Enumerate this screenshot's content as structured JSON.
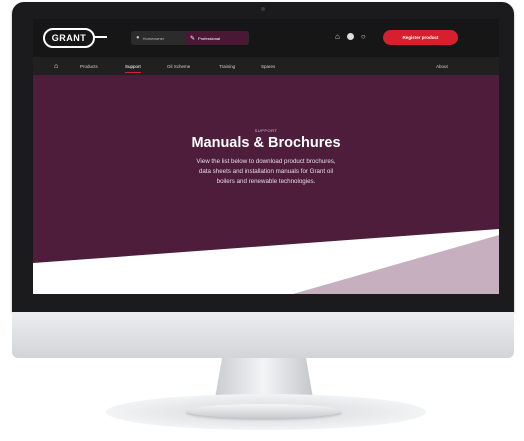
{
  "header": {
    "logo_text": "GRANT",
    "toggle": {
      "homeowner_label": "Homeowner",
      "professional_label": "Professional"
    },
    "icons": [
      "bag-icon",
      "account-icon",
      "search-icon"
    ],
    "register_label": "Register product"
  },
  "nav": {
    "items": [
      {
        "label": "Products"
      },
      {
        "label": "Support"
      },
      {
        "label": "Oil Scheme"
      },
      {
        "label": "Training"
      },
      {
        "label": "Spares"
      },
      {
        "label": "About"
      }
    ],
    "active": "Support"
  },
  "hero": {
    "breadcrumb": "SUPPORT",
    "title": "Manuals & Brochures",
    "description": "View the list below to download product brochures, data sheets and installation manuals for Grant oil boilers and renewable technologies."
  },
  "colors": {
    "brand_purple": "#4d1d3b",
    "accent_red": "#d6202e",
    "light_mauve": "#c6b0bf",
    "topbar": "#161616"
  }
}
